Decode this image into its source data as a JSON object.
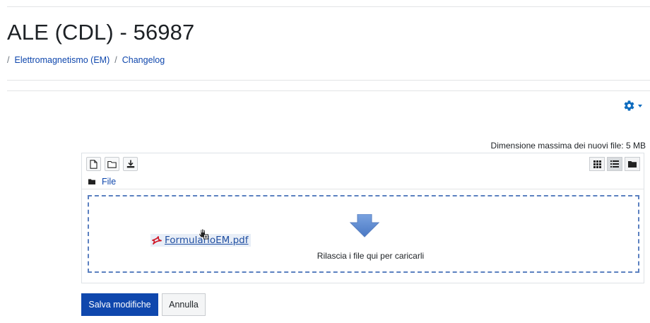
{
  "header": {
    "title": "ALE (CDL) - 56987",
    "breadcrumb": [
      {
        "label": "Elettromagnetismo (EM)"
      },
      {
        "label": "Changelog"
      }
    ],
    "separator": "/"
  },
  "settings_menu": {
    "icon": "gear-icon"
  },
  "filepicker": {
    "max_size_label": "Dimensione massima dei nuovi file:",
    "max_size_value": "5 MB",
    "toolbar": {
      "add_file_icon": "new-file-icon",
      "create_folder_icon": "folder-icon",
      "download_icon": "download-icon"
    },
    "views": {
      "icons_icon": "grid-icon",
      "list_icon": "list-icon",
      "tree_icon": "folder-icon",
      "active": "list"
    },
    "path_label": "File",
    "drop_hint": "Rilascia i file qui per caricarli",
    "dragged_file": {
      "name": "FormularioEM.pdf",
      "icon": "pdf-icon"
    }
  },
  "actions": {
    "save_label": "Salva modifiche",
    "cancel_label": "Annulla"
  },
  "colors": {
    "primary": "#0f47ad",
    "link": "#0f47ad",
    "drop_border": "#5b80c0",
    "pdf_red": "#d11a2a"
  }
}
